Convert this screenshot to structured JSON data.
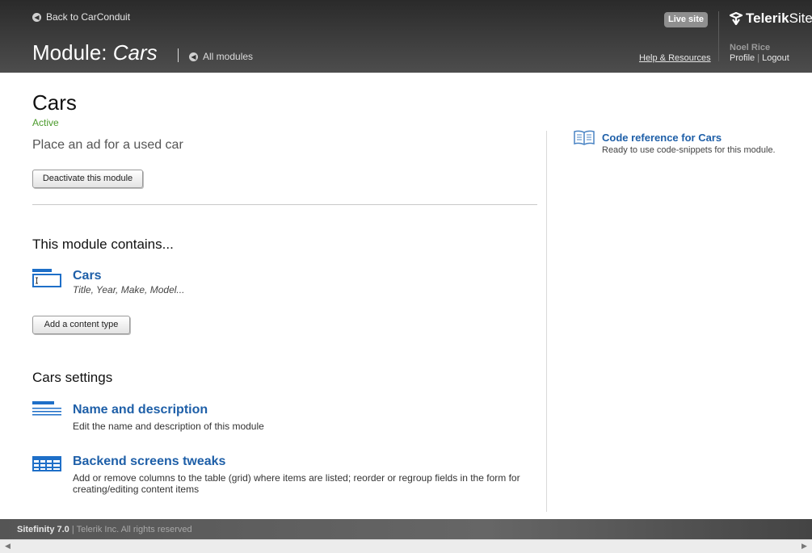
{
  "header": {
    "back_label": "Back to CarConduit",
    "module_prefix": "Module: ",
    "module_name": "Cars",
    "all_modules_label": "All modules",
    "live_site_label": "Live site",
    "help_label": "Help & Resources",
    "logo_bold": "Telerik",
    "logo_light": "Site",
    "user_name": "Noel Rice",
    "profile_label": "Profile",
    "separator": "|",
    "logout_label": "Logout"
  },
  "main": {
    "title": "Cars",
    "status": "Active",
    "description": "Place an ad for a used car",
    "deactivate_label": "Deactivate this module",
    "contains_heading": "This module contains...",
    "content_type": {
      "name": "Cars",
      "fields": "Title, Year, Make, Model..."
    },
    "add_content_type_label": "Add a content type",
    "settings_heading": "Cars settings",
    "settings": [
      {
        "title": "Name and description",
        "description": "Edit the name and description of this module"
      },
      {
        "title": "Backend screens tweaks",
        "description_line1": "Add or remove columns to the table (grid) where items are listed; reorder or regroup fields in the form for",
        "description_line2": "creating/editing content items"
      }
    ]
  },
  "sidebar": {
    "code_reference_label": "Code reference for Cars",
    "code_reference_desc": "Ready to use code-snippets for this module."
  },
  "footer": {
    "product": "Sitefinity 7.0",
    "copyright": "| Telerik Inc. All rights reserved"
  },
  "icons": {
    "back": "circle-left-arrow-icon",
    "book": "book-icon",
    "content_type": "content-type-icon",
    "name_description": "lines-icon",
    "grid": "grid-icon"
  },
  "colors": {
    "link": "#1e5fa8",
    "status_active": "#4a9a2a",
    "header_bg": "#3a3a3a"
  }
}
